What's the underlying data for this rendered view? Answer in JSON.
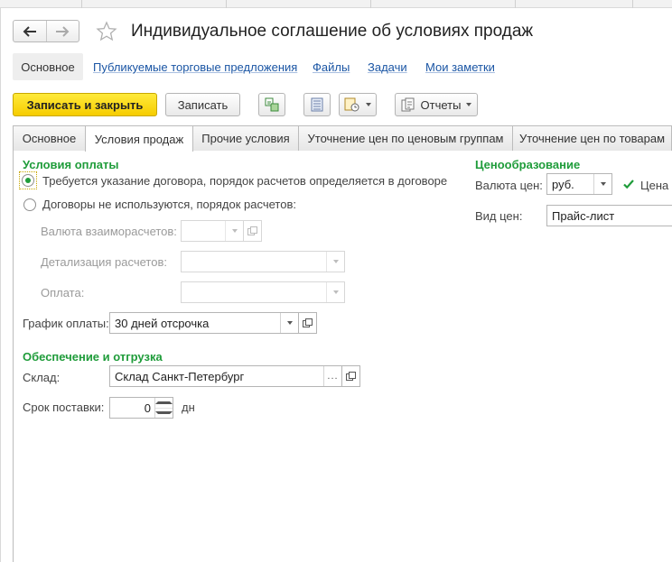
{
  "window": {
    "title": "Индивидуальное соглашение об условиях продаж"
  },
  "nav": {
    "back_icon": "arrow-left-icon",
    "forward_icon": "arrow-right-icon",
    "favorite_icon": "star-icon"
  },
  "links": {
    "active": "Основное",
    "items": [
      "Публикуемые торговые предложения",
      "Файлы",
      "Задачи",
      "Мои заметки"
    ]
  },
  "toolbar": {
    "save_close_label": "Записать и закрыть",
    "save_label": "Записать",
    "reports_label": "Отчеты"
  },
  "tabs": [
    "Основное",
    "Условия продаж",
    "Прочие условия",
    "Уточнение цен по ценовым группам",
    "Уточнение цен по товарам"
  ],
  "active_tab": "Условия продаж",
  "payment": {
    "section_title": "Условия оплаты",
    "radio_contract_required": "Требуется указание договора, порядок расчетов определяется в договоре",
    "radio_no_contract": "Договоры не используются, порядок расчетов:",
    "settlement_currency_label": "Валюта взаиморасчетов:",
    "settlement_detail_label": "Детализация расчетов:",
    "payment_label": "Оплата:",
    "schedule_label": "График оплаты:",
    "schedule_value": "30 дней отсрочка"
  },
  "shipping": {
    "section_title": "Обеспечение и отгрузка",
    "warehouse_label": "Склад:",
    "warehouse_value": "Склад Санкт-Петербург",
    "lead_time_label": "Срок поставки:",
    "lead_time_value": "0",
    "lead_time_unit": "дн"
  },
  "pricing": {
    "section_title": "Ценообразование",
    "currency_label": "Валюта цен:",
    "currency_value": "руб.",
    "price_checkbox_label": "Цена",
    "price_checkbox_checked": true,
    "price_type_label": "Вид цен:",
    "price_type_value": "Прайс-лист"
  },
  "colors": {
    "accent_green": "#1f9c3a",
    "primary_yellow": "#f6cc00",
    "link_blue": "#1a55a4"
  }
}
